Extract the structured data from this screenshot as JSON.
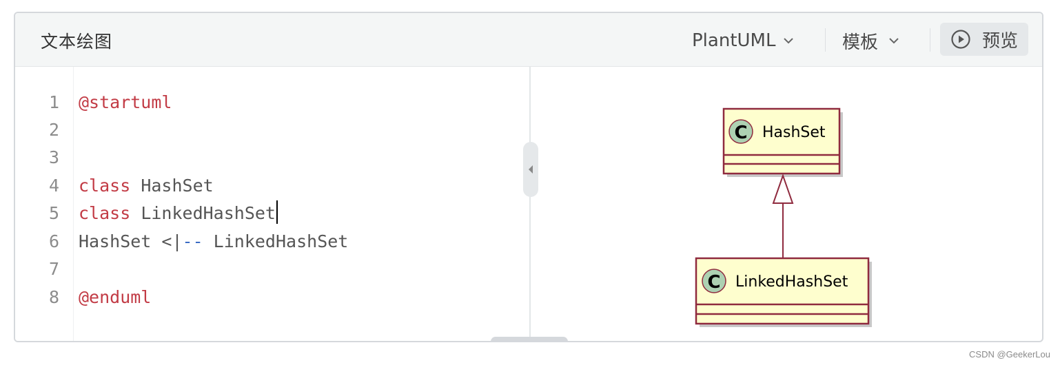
{
  "header": {
    "title": "文本绘图",
    "language_dropdown": "PlantUML",
    "template_dropdown": "模板",
    "preview_button": "预览"
  },
  "editor": {
    "line_numbers": [
      "1",
      "2",
      "3",
      "4",
      "5",
      "6",
      "7",
      "8"
    ],
    "lines": {
      "l1": "@startuml",
      "l4_kw": "class",
      "l4_rest": " HashSet",
      "l5_kw": "class",
      "l5_rest": " LinkedHashSet",
      "l6_a": "HashSet <|",
      "l6_b": "--",
      "l6_c": " LinkedHashSet",
      "l8": "@enduml"
    }
  },
  "diagram": {
    "classes": [
      {
        "name": "HashSet",
        "stereotype_letter": "C"
      },
      {
        "name": "LinkedHashSet",
        "stereotype_letter": "C"
      }
    ],
    "relationship": "LinkedHashSet extends HashSet",
    "colors": {
      "box_fill": "#fefece",
      "box_border": "#8f2a3e",
      "circle_fill": "#add1b2",
      "shadow": "#c8c8c8"
    }
  },
  "watermark": "CSDN @GeekerLou",
  "colors": {
    "keyword": "#c23b45",
    "operator": "#3a6bc4",
    "header_bg": "#f4f6f6"
  }
}
